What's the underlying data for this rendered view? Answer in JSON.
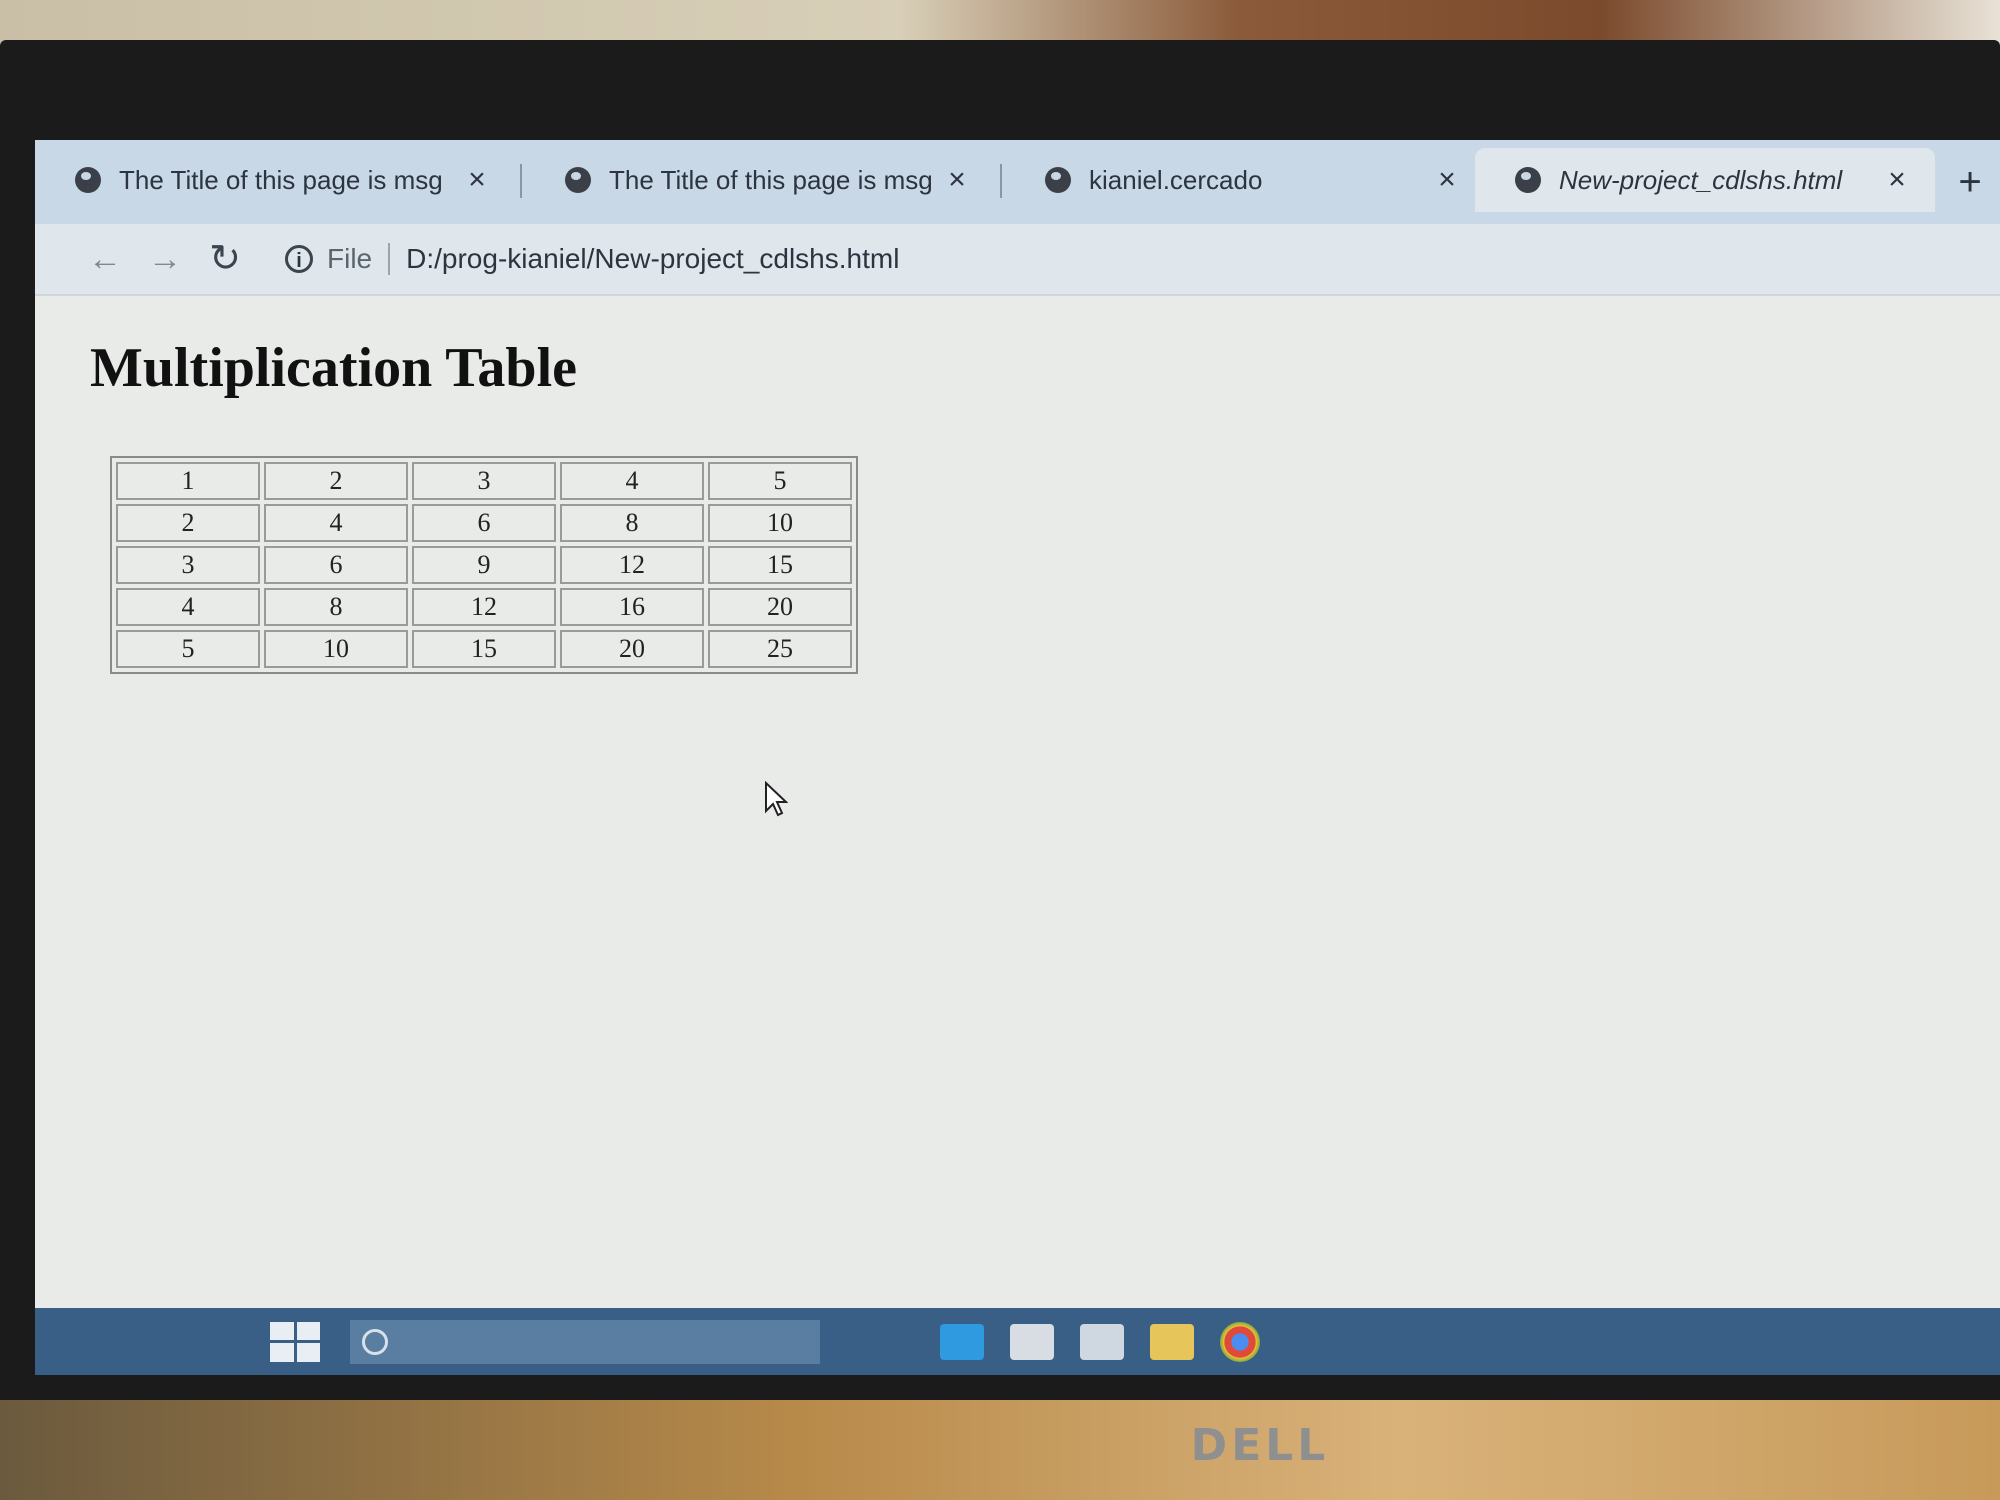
{
  "browser": {
    "tabs": [
      {
        "title": "The Title of this page is msg",
        "active": false
      },
      {
        "title": "The Title of this page is msg",
        "active": false
      },
      {
        "title": "kianiel.cercado",
        "active": false
      },
      {
        "title": "New-project_cdlshs.html",
        "active": true
      }
    ],
    "new_tab_label": "+",
    "close_label": "×",
    "address": {
      "scheme_label": "File",
      "url": "D:/prog-kianiel/New-project_cdlshs.html"
    }
  },
  "page": {
    "heading": "Multiplication Table",
    "table_rows": [
      [
        "1",
        "2",
        "3",
        "4",
        "5"
      ],
      [
        "2",
        "4",
        "6",
        "8",
        "10"
      ],
      [
        "3",
        "6",
        "9",
        "12",
        "15"
      ],
      [
        "4",
        "8",
        "12",
        "16",
        "20"
      ],
      [
        "5",
        "10",
        "15",
        "20",
        "25"
      ]
    ]
  },
  "monitor": {
    "brand": "DELL"
  },
  "icons": [
    "globe-icon",
    "back-icon",
    "forward-icon",
    "reload-icon",
    "info-icon",
    "windows-start-icon",
    "search-icon",
    "edge-icon",
    "store-icon",
    "mail-icon",
    "explorer-icon",
    "chrome-icon"
  ],
  "colors": {
    "tab_strip": "#c9d8e6",
    "toolbar": "#dfe6ec",
    "page_bg": "#e9ebe9",
    "taskbar": "#3a5f86"
  }
}
